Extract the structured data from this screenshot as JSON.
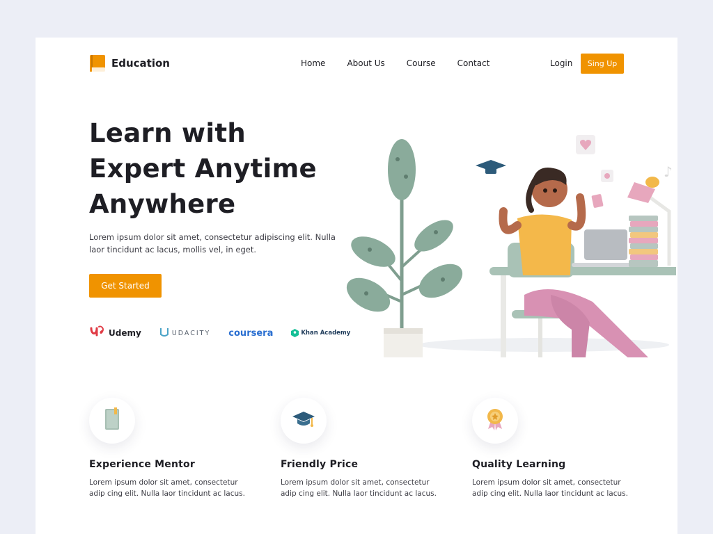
{
  "brand": {
    "name": "Education",
    "accent": "#f09300"
  },
  "nav": {
    "links": [
      "Home",
      "About Us",
      "Course",
      "Contact"
    ],
    "login": "Login",
    "signup": "Sing Up"
  },
  "hero": {
    "title_lines": [
      "Learn with",
      "Expert Anytime",
      "Anywhere"
    ],
    "description": "Lorem ipsum dolor sit amet, consectetur adipiscing elit. Nulla laor tincidunt ac lacus, mollis vel, in eget.",
    "cta": "Get Started",
    "illustration_icon": "student-desk-illustration"
  },
  "partners": [
    {
      "name": "Udemy",
      "icon": "udemy-logo"
    },
    {
      "name": "UDACITY",
      "icon": "udacity-logo"
    },
    {
      "name": "coursera",
      "icon": "coursera-logo"
    },
    {
      "name": "Khan Academy",
      "icon": "khan-academy-logo"
    }
  ],
  "features": [
    {
      "title": "Experience Mentor",
      "description": "Lorem ipsum dolor sit amet, consectetur adip cing elit. Nulla laor tincidunt ac lacus.",
      "icon": "book-icon"
    },
    {
      "title": "Friendly Price",
      "description": "Lorem ipsum dolor sit amet, consectetur adip cing elit. Nulla laor tincidunt ac lacus.",
      "icon": "graduation-cap-icon"
    },
    {
      "title": "Quality Learning",
      "description": "Lorem ipsum dolor sit amet, consectetur adip cing elit. Nulla laor tincidunt ac lacus.",
      "icon": "award-medal-icon"
    }
  ]
}
